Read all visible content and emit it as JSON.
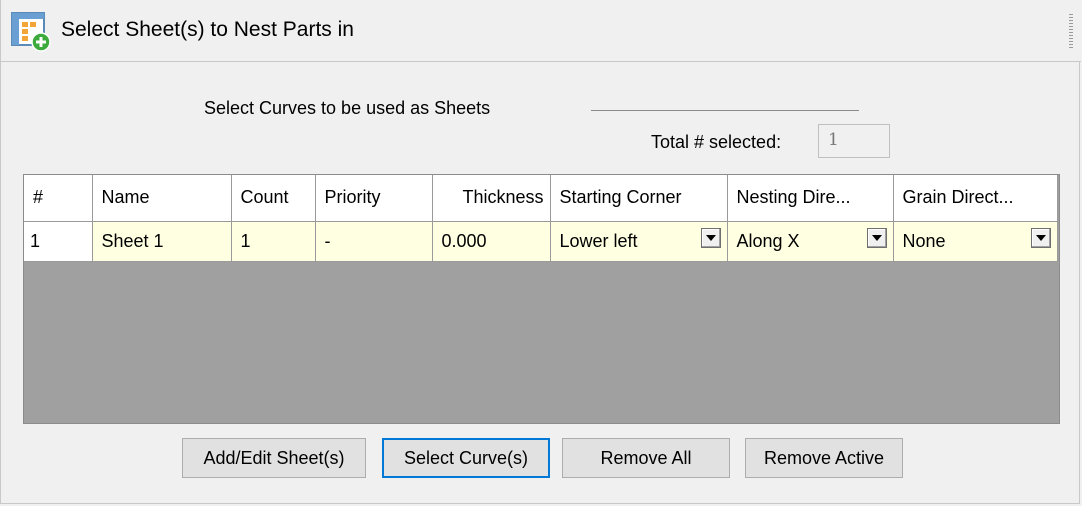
{
  "header": {
    "title": "Select Sheet(s) to Nest Parts in"
  },
  "selection": {
    "label": "Select Curves to be used as Sheets",
    "total_label": "Total # selected:",
    "total_value": "1"
  },
  "table": {
    "columns": [
      "#",
      "Name",
      "Count",
      "Priority",
      "Thickness",
      "Starting Corner",
      "Nesting Dire...",
      "Grain Direct..."
    ],
    "rows": [
      {
        "index": "1",
        "name": "Sheet 1",
        "count": "1",
        "priority": "-",
        "thickness": "0.000",
        "starting_corner": "Lower left",
        "nesting_direction": "Along X",
        "grain_direction": "None"
      }
    ]
  },
  "buttons": {
    "add_edit": "Add/Edit Sheet(s)",
    "select_curve": "Select Curve(s)",
    "remove_all": "Remove All",
    "remove_active": "Remove Active"
  },
  "colors": {
    "row_highlight": "#ffffe1",
    "grid_empty": "#a0a0a0",
    "focus_border": "#0078d7"
  }
}
